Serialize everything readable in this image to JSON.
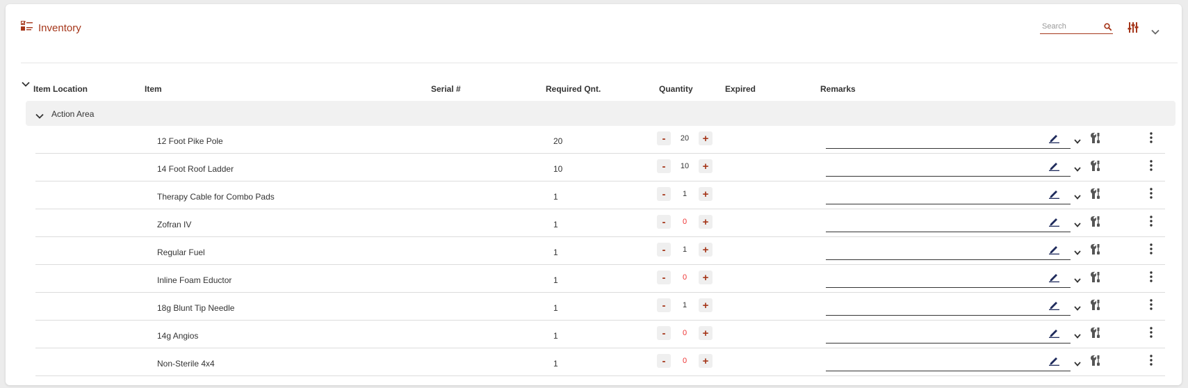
{
  "header": {
    "title": "Inventory",
    "search_placeholder": "Search"
  },
  "columns": {
    "location": "Item Location",
    "item": "Item",
    "serial": "Serial #",
    "required": "Required Qnt.",
    "quantity": "Quantity",
    "expired": "Expired",
    "remarks": "Remarks"
  },
  "group": {
    "label": "Action Area"
  },
  "rows": [
    {
      "item": "12 Foot Pike Pole",
      "required": "20",
      "quantity": "20"
    },
    {
      "item": "14 Foot Roof Ladder",
      "required": "10",
      "quantity": "10"
    },
    {
      "item": "Therapy Cable for Combo Pads",
      "required": "1",
      "quantity": "1"
    },
    {
      "item": "Zofran IV",
      "required": "1",
      "quantity": "0"
    },
    {
      "item": "Regular Fuel",
      "required": "1",
      "quantity": "1"
    },
    {
      "item": "Inline Foam Eductor",
      "required": "1",
      "quantity": "0"
    },
    {
      "item": "18g Blunt Tip Needle",
      "required": "1",
      "quantity": "1"
    },
    {
      "item": "14g Angios",
      "required": "1",
      "quantity": "0"
    },
    {
      "item": "Non-Sterile 4x4",
      "required": "1",
      "quantity": "0"
    }
  ],
  "controls": {
    "minus": "-",
    "plus": "+"
  },
  "colors": {
    "accent": "#a5361a",
    "zero_quantity": "#e33333",
    "pen": "#1f2b5c"
  },
  "icons": {
    "title": "checklist-icon",
    "search": "search-icon",
    "filter": "sliders-icon",
    "collapse": "chevron-down-icon",
    "edit": "pen-icon",
    "tools": "wrench-screwdriver-icon",
    "more": "more-vertical-icon"
  }
}
